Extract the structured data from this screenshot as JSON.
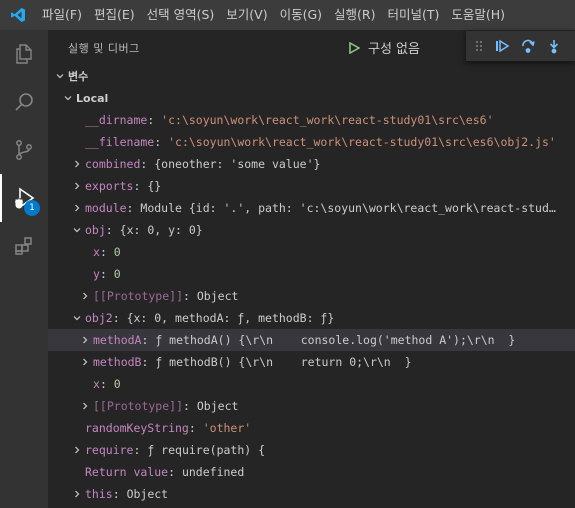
{
  "menu": {
    "items": [
      "파일(F)",
      "편집(E)",
      "선택 영역(S)",
      "보기(V)",
      "이동(G)",
      "실행(R)",
      "터미널(T)",
      "도움말(H)"
    ]
  },
  "activity_bar": {
    "icons": [
      "files-icon",
      "search-icon",
      "source-control-icon",
      "run-debug-icon",
      "extensions-icon"
    ],
    "debug_badge": "1"
  },
  "sidebar": {
    "title": "실행 및 디버그",
    "config_label": "구성 없음"
  },
  "debug_toolbar": {
    "buttons": [
      "drag-grip",
      "continue",
      "step-over",
      "step-into"
    ]
  },
  "variables": {
    "section_label": "변수",
    "scope_label": "Local",
    "rows": [
      {
        "name": "__dirname",
        "value": "'c:\\soyun\\work\\react_work\\react-study01\\src\\es6'",
        "kind": "str"
      },
      {
        "name": "__filename",
        "value": "'c:\\soyun\\work\\react_work\\react-study01\\src\\es6\\obj2.js'",
        "kind": "str"
      },
      {
        "name": "combined",
        "value": "{oneother: 'some value'}",
        "kind": "obj"
      },
      {
        "name": "exports",
        "value": "{}",
        "kind": "obj"
      },
      {
        "name": "module",
        "value": "Module {id: '.', path: 'c:\\soyun\\work\\react_work\\react-stud…",
        "kind": "obj"
      },
      {
        "name": "obj",
        "value": "{x: 0, y: 0}",
        "kind": "obj"
      },
      {
        "name": "x",
        "value": "0",
        "kind": "num"
      },
      {
        "name": "y",
        "value": "0",
        "kind": "num"
      },
      {
        "name": "[[Prototype]]",
        "value": "Object",
        "kind": "obj"
      },
      {
        "name": "obj2",
        "value": "{x: 0, methodA: ƒ, methodB: ƒ}",
        "kind": "obj"
      },
      {
        "name": "methodA",
        "value": "ƒ methodA() {\\r\\n    console.log('method A');\\r\\n  }",
        "kind": "fn"
      },
      {
        "name": "methodB",
        "value": "ƒ methodB() {\\r\\n    return 0;\\r\\n  }",
        "kind": "fn"
      },
      {
        "name": "x",
        "value": "0",
        "kind": "num"
      },
      {
        "name": "[[Prototype]]",
        "value": "Object",
        "kind": "obj"
      },
      {
        "name": "randomKeyString",
        "value": "'other'",
        "kind": "str"
      },
      {
        "name": "require",
        "value": "ƒ require(path) {",
        "kind": "fn"
      },
      {
        "name": "Return value",
        "value": "undefined",
        "kind": "undef"
      },
      {
        "name": "this",
        "value": "Object",
        "kind": "obj"
      }
    ]
  },
  "colors": {
    "accent": "#007acc",
    "name": "#c586c0",
    "string": "#ce9178",
    "number": "#b5cea8",
    "debug_green": "#89d185",
    "debug_blue": "#75beff"
  }
}
